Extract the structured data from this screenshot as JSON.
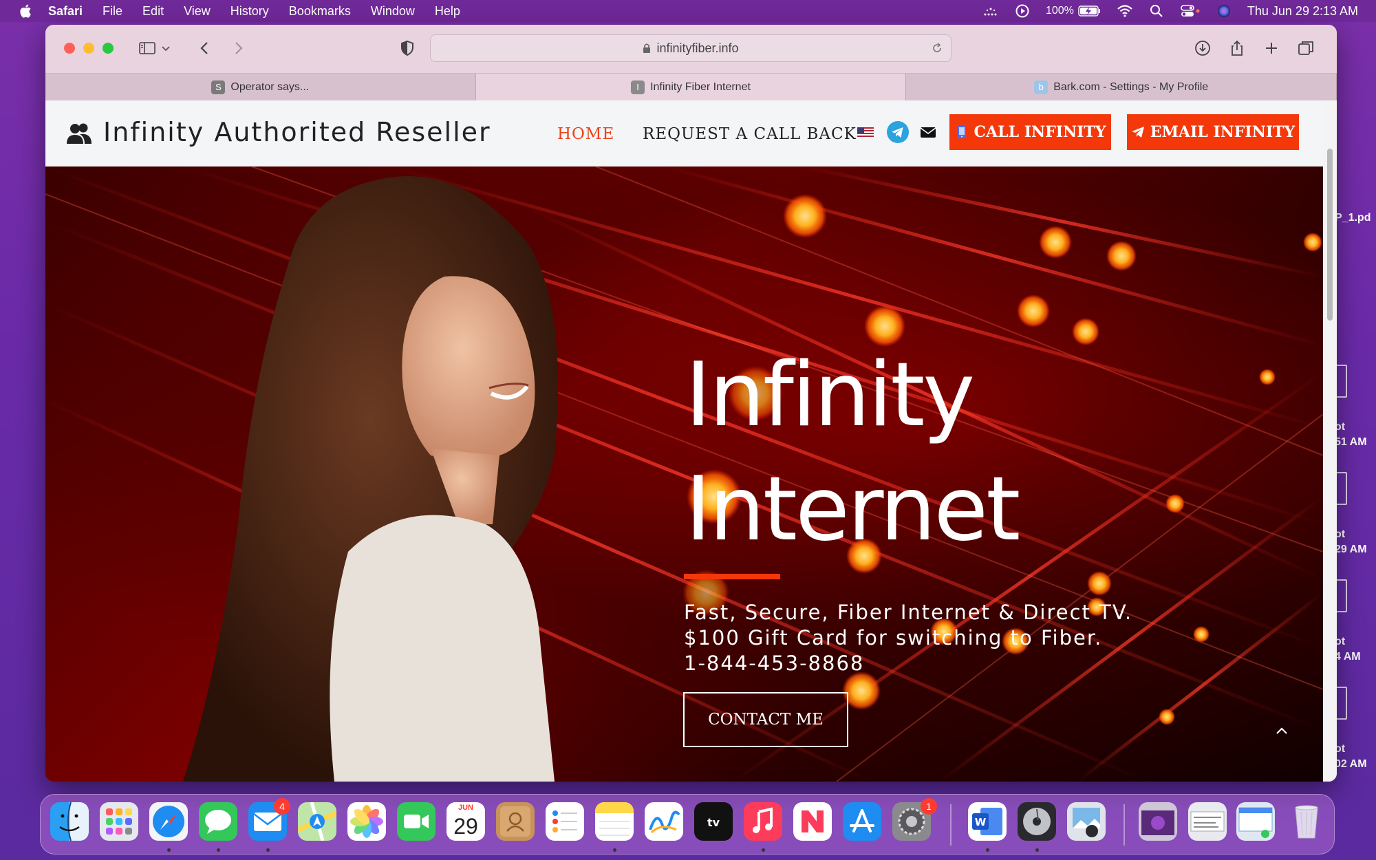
{
  "menubar": {
    "app_name": "Safari",
    "items": [
      "File",
      "Edit",
      "View",
      "History",
      "Bookmarks",
      "Window",
      "Help"
    ],
    "battery": "100%",
    "clock": "Thu Jun 29  2:13 AM"
  },
  "desktop": {
    "labels": [
      "P_1.pd",
      "ot",
      "51 AM",
      "ot",
      "29 AM",
      "ot",
      "4 AM",
      "ot",
      "02 AM"
    ]
  },
  "browser": {
    "url": "infinityfiber.info",
    "tabs": [
      {
        "label": "Operator says...",
        "favicon": "S",
        "favicon_color": "#7a7a7a"
      },
      {
        "label": "Infinity Fiber Internet",
        "favicon": "I",
        "favicon_color": "#8a8a8a"
      },
      {
        "label": "Bark.com - Settings - My Profile",
        "favicon": "b",
        "favicon_color": "#9ec5e8"
      }
    ]
  },
  "site": {
    "title": "Infinity Authorited Reseller",
    "nav": {
      "home": "HOME",
      "callback": "REQUEST A CALL BACK"
    },
    "cta_call": "CALL INFINITY",
    "cta_email": "EMAIL INFINITY",
    "accent": "#f4380a"
  },
  "hero": {
    "title_line1": "Infinity",
    "title_line2": "Internet",
    "sub_line1": "Fast, Secure, Fiber Internet & Direct TV.",
    "sub_line2": "$100 Gift Card for switching to Fiber.",
    "sub_line3": "1-844-453-8868",
    "contact_button": "CONTACT ME"
  },
  "dock": {
    "calendar_month": "JUN",
    "calendar_day": "29",
    "mail_badge": "4",
    "settings_badge": "1"
  }
}
